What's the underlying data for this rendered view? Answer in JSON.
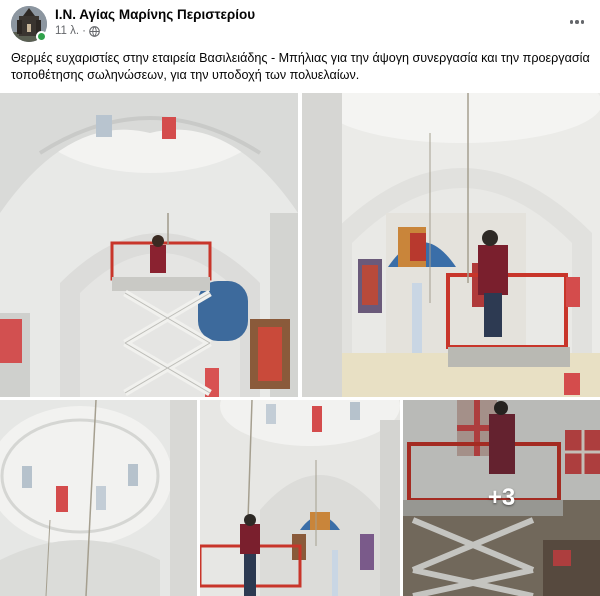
{
  "post": {
    "author": "Ι.Ν. Αγίας Μαρίνης Περιστερίου",
    "time": "11 λ.",
    "separator": "·",
    "caption": "Θερμές ευχαριστίες στην εταιρεία Βασιλειάδης - Μπήλιας για την άψογη συνεργασία και την προεργασία  τοποθέτησης σωληνώσεων, για την υποδοχή των πολυελαίων.",
    "more_photos": "+3"
  },
  "icons": {
    "avatar": "church-avatar",
    "privacy": "globe-icon",
    "menu": "more-options-icon",
    "online": "online-status-dot"
  },
  "colors": {
    "text_primary": "#050505",
    "text_secondary": "#65676b",
    "online_green": "#31a24c",
    "lift_red": "#c8352a"
  }
}
